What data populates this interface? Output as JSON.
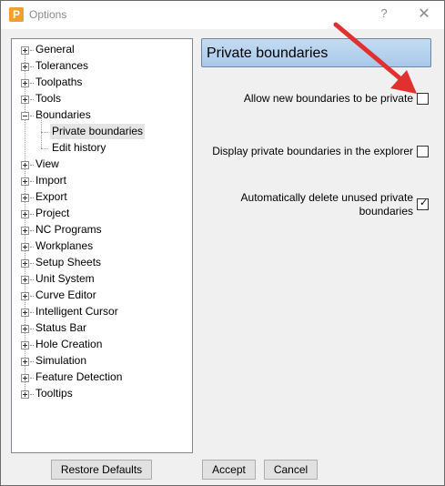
{
  "window": {
    "title": "Options",
    "icon_letter": "P",
    "help_glyph": "?",
    "close_glyph": "✕"
  },
  "tree": {
    "items": [
      {
        "label": "General",
        "expanded": false
      },
      {
        "label": "Tolerances",
        "expanded": false
      },
      {
        "label": "Toolpaths",
        "expanded": false
      },
      {
        "label": "Tools",
        "expanded": false
      },
      {
        "label": "Boundaries",
        "expanded": true
      },
      {
        "label": "Private boundaries",
        "child": true,
        "selected": true
      },
      {
        "label": "Edit history",
        "child": true
      },
      {
        "label": "View",
        "expanded": false
      },
      {
        "label": "Import",
        "expanded": false
      },
      {
        "label": "Export",
        "expanded": false
      },
      {
        "label": "Project",
        "expanded": false
      },
      {
        "label": "NC Programs",
        "expanded": false
      },
      {
        "label": "Workplanes",
        "expanded": false
      },
      {
        "label": "Setup Sheets",
        "expanded": false
      },
      {
        "label": "Unit System",
        "expanded": false
      },
      {
        "label": "Curve Editor",
        "expanded": false
      },
      {
        "label": "Intelligent Cursor",
        "expanded": false
      },
      {
        "label": "Status Bar",
        "expanded": false
      },
      {
        "label": "Hole Creation",
        "expanded": false
      },
      {
        "label": "Simulation",
        "expanded": false
      },
      {
        "label": "Feature Detection",
        "expanded": false
      },
      {
        "label": "Tooltips",
        "expanded": false
      }
    ]
  },
  "panel": {
    "title": "Private boundaries",
    "options": [
      {
        "label_lines": [
          "Allow new boundaries to be private"
        ],
        "checked": false
      },
      {
        "label_lines": [
          "Display private boundaries in the explorer"
        ],
        "checked": false
      },
      {
        "label_lines": [
          "Automatically delete unused private",
          "boundaries"
        ],
        "checked": true
      }
    ],
    "annotation_arrow_color": "#e03030"
  },
  "buttons": {
    "restore_defaults": "Restore Defaults",
    "accept": "Accept",
    "cancel": "Cancel"
  },
  "checkmark_glyph": "✓"
}
